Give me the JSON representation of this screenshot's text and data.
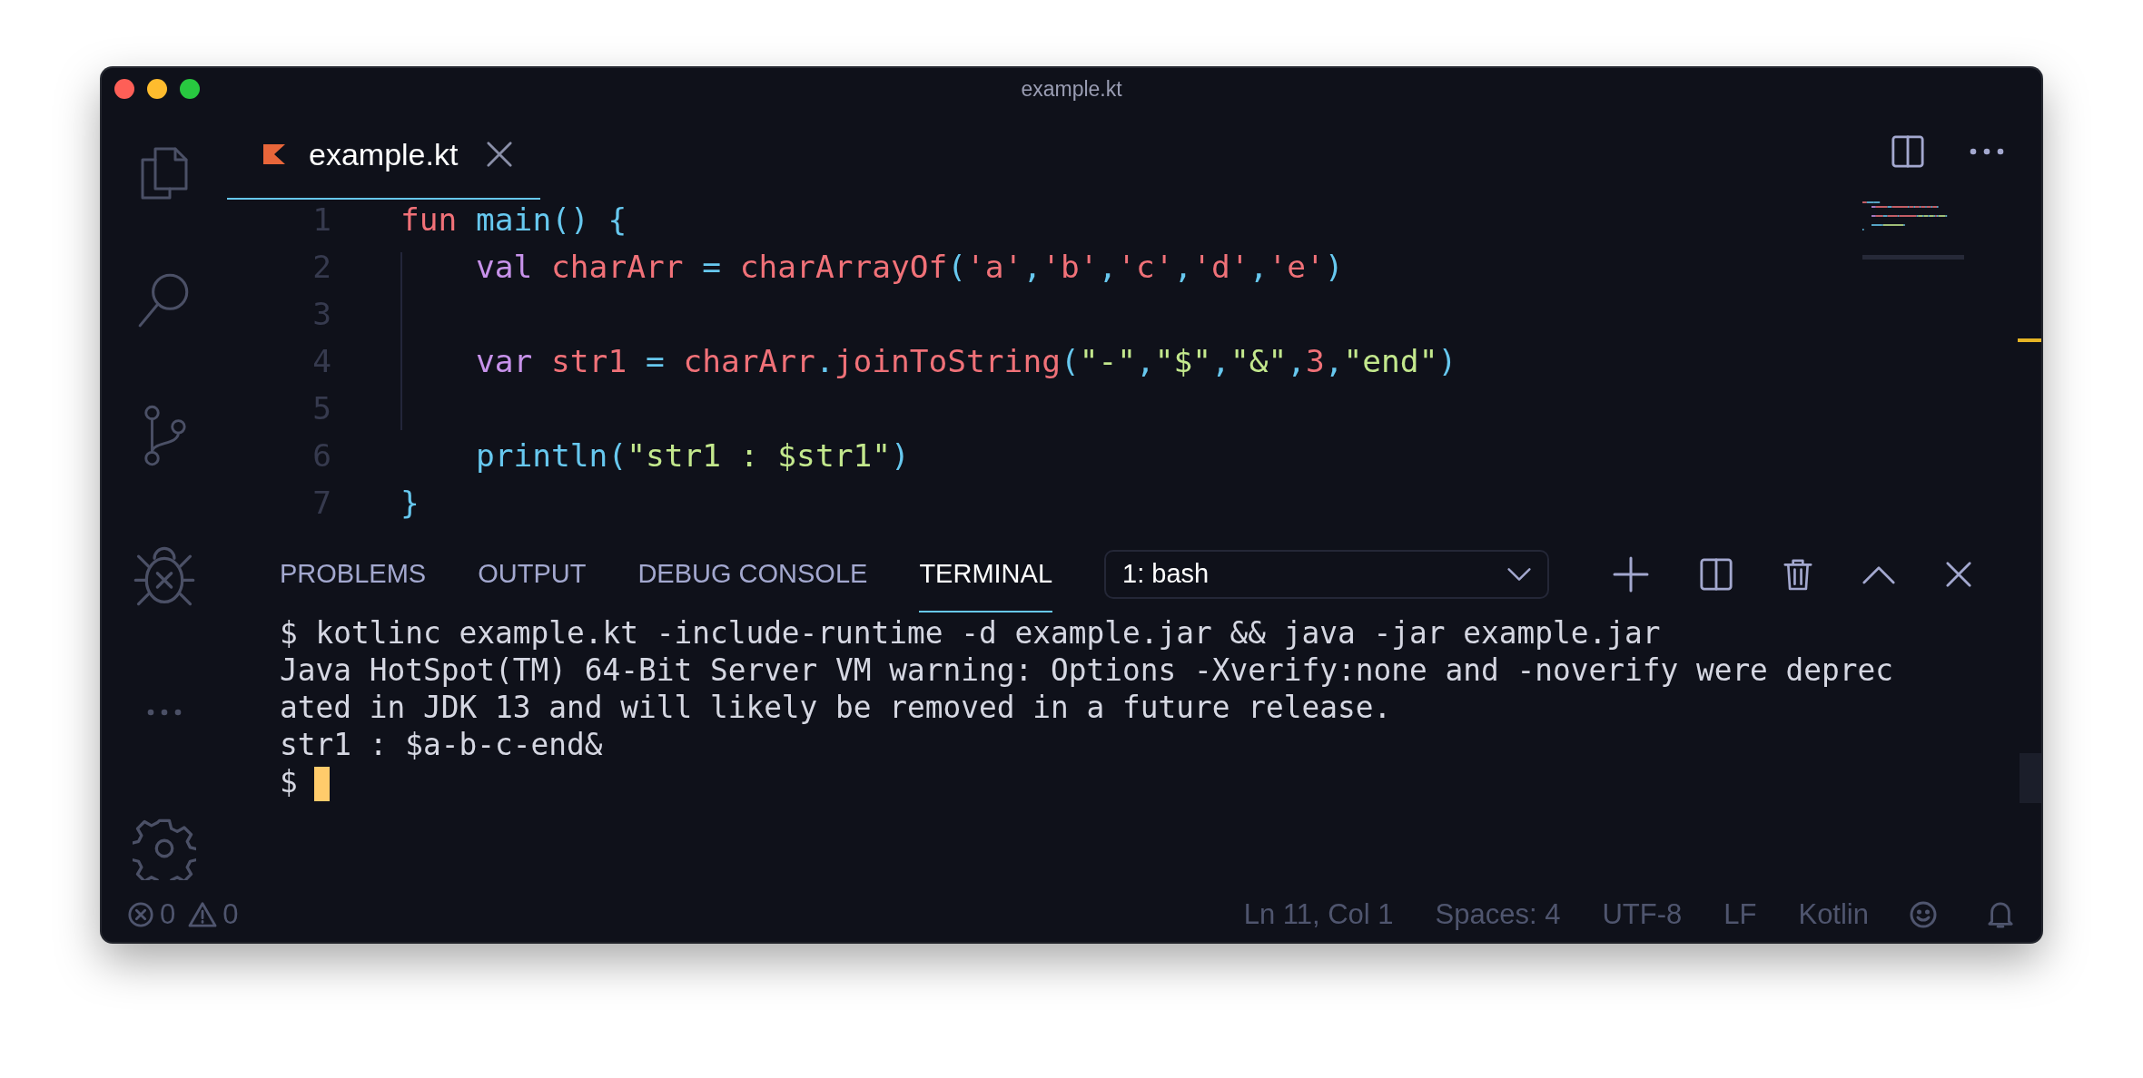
{
  "window": {
    "title": "example.kt"
  },
  "editor_tabs": [
    {
      "label": "example.kt",
      "selected": true
    }
  ],
  "code": [
    {
      "number": "1",
      "indented": false,
      "tokens": [
        {
          "kind": "keyword",
          "text": "fun"
        },
        {
          "kind": "function",
          "text": " main"
        },
        {
          "kind": "punct",
          "text": "() {"
        }
      ]
    },
    {
      "number": "2",
      "indented": true,
      "tokens": [
        {
          "kind": "declare",
          "text": "val"
        },
        {
          "kind": "ident",
          "text": " charArr"
        },
        {
          "kind": "punct",
          "text": " = "
        },
        {
          "kind": "ident",
          "text": "charArrayOf"
        },
        {
          "kind": "punct",
          "text": "("
        },
        {
          "kind": "char",
          "text": "'a'"
        },
        {
          "kind": "punct",
          "text": ","
        },
        {
          "kind": "char",
          "text": "'b'"
        },
        {
          "kind": "punct",
          "text": ","
        },
        {
          "kind": "char",
          "text": "'c'"
        },
        {
          "kind": "punct",
          "text": ","
        },
        {
          "kind": "char",
          "text": "'d'"
        },
        {
          "kind": "punct",
          "text": ","
        },
        {
          "kind": "char",
          "text": "'e'"
        },
        {
          "kind": "punct",
          "text": ")"
        }
      ]
    },
    {
      "number": "3"
    },
    {
      "number": "4",
      "indented": true,
      "tokens": [
        {
          "kind": "declare",
          "text": "var"
        },
        {
          "kind": "ident",
          "text": " str1"
        },
        {
          "kind": "punct",
          "text": " = "
        },
        {
          "kind": "ident",
          "text": "charArr"
        },
        {
          "kind": "punct",
          "text": "."
        },
        {
          "kind": "ident",
          "text": "joinToString"
        },
        {
          "kind": "punct",
          "text": "("
        },
        {
          "kind": "string",
          "text": "\"-\""
        },
        {
          "kind": "punct",
          "text": ","
        },
        {
          "kind": "string",
          "text": "\"$\""
        },
        {
          "kind": "punct",
          "text": ","
        },
        {
          "kind": "string",
          "text": "\"&\""
        },
        {
          "kind": "punct",
          "text": ","
        },
        {
          "kind": "number",
          "text": "3"
        },
        {
          "kind": "punct",
          "text": ","
        },
        {
          "kind": "string",
          "text": "\"end\""
        },
        {
          "kind": "punct",
          "text": ")"
        }
      ]
    },
    {
      "number": "5"
    },
    {
      "number": "6",
      "indented": true,
      "tokens": [
        {
          "kind": "function",
          "text": "println"
        },
        {
          "kind": "punct",
          "text": "("
        },
        {
          "kind": "string",
          "text": "\"str1 : $str1\""
        },
        {
          "kind": "punct",
          "text": ")"
        }
      ]
    },
    {
      "number": "7",
      "indented": false,
      "tokens": [
        {
          "kind": "punct",
          "text": "}"
        }
      ]
    }
  ],
  "panel": {
    "tabs": [
      {
        "label": "PROBLEMS",
        "selected": false
      },
      {
        "label": "OUTPUT",
        "selected": false
      },
      {
        "label": "DEBUG CONSOLE",
        "selected": false
      },
      {
        "label": "TERMINAL",
        "selected": true
      }
    ],
    "terminal_select": {
      "value": "1: bash"
    },
    "terminal_lines": [
      "$ kotlinc example.kt -include-runtime -d example.jar && java -jar example.jar",
      "Java HotSpot(TM) 64-Bit Server VM warning: Options -Xverify:none and -noverify were deprec",
      "ated in JDK 13 and will likely be removed in a future release.",
      "str1 : $a-b-c-end&"
    ],
    "prompt": "$"
  },
  "status_bar": {
    "errors": "0",
    "warnings": "0",
    "items": [
      "Ln 11, Col 1",
      "Spaces: 4",
      "UTF-8",
      "LF",
      "Kotlin"
    ]
  }
}
